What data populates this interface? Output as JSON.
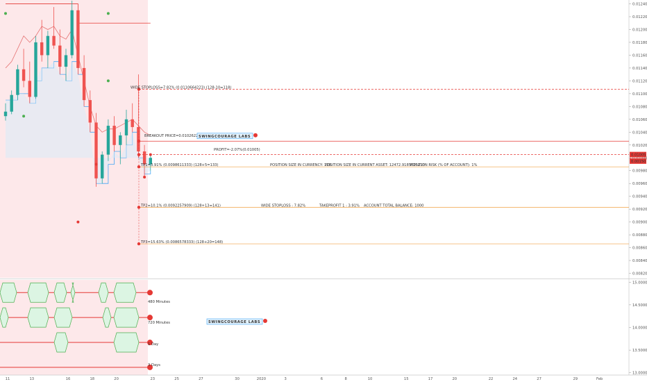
{
  "chart_data": {
    "type": "candlestick",
    "price_axis_ticks": [
      "0.01240",
      "0.01220",
      "0.01200",
      "0.01180",
      "0.01160",
      "0.01140",
      "0.01120",
      "0.01100",
      "0.01080",
      "0.01060",
      "0.01040",
      "0.01020",
      "0.01000",
      "0.00980",
      "0.00960",
      "0.00940",
      "0.00920",
      "0.00900",
      "0.00880",
      "0.00860",
      "0.00840",
      "0.00820"
    ],
    "ylim": [
      0.00813,
      0.01246
    ],
    "osc_axis_ticks": [
      "15.00000",
      "14.50000",
      "14.00000",
      "13.50000",
      "13.00000"
    ],
    "osc_ylim": [
      12.95,
      15.05
    ],
    "x_axis_ticks": [
      {
        "label": "11",
        "idx": 0
      },
      {
        "label": "13",
        "idx": 4
      },
      {
        "label": "16",
        "idx": 10
      },
      {
        "label": "18",
        "idx": 14
      },
      {
        "label": "20",
        "idx": 18
      },
      {
        "label": "23",
        "idx": 24
      },
      {
        "label": "25",
        "idx": 28
      },
      {
        "label": "27",
        "idx": 32
      },
      {
        "label": "30",
        "idx": 38
      },
      {
        "label": "2020",
        "idx": 42
      },
      {
        "label": "3",
        "idx": 46
      },
      {
        "label": "6",
        "idx": 52
      },
      {
        "label": "8",
        "idx": 56
      },
      {
        "label": "10",
        "idx": 60
      },
      {
        "label": "15",
        "idx": 66
      },
      {
        "label": "17",
        "idx": 70
      },
      {
        "label": "20",
        "idx": 74
      },
      {
        "label": "22",
        "idx": 80
      },
      {
        "label": "24",
        "idx": 84
      },
      {
        "label": "27",
        "idx": 88
      },
      {
        "label": "29",
        "idx": 94
      },
      {
        "label": "Feb",
        "idx": 98
      }
    ],
    "candles": [
      [
        0.01065,
        0.01085,
        0.01058,
        0.01072
      ],
      [
        0.01072,
        0.01105,
        0.01068,
        0.01098
      ],
      [
        0.01098,
        0.01145,
        0.0109,
        0.01138
      ],
      [
        0.01138,
        0.0117,
        0.0111,
        0.0112
      ],
      [
        0.0112,
        0.0115,
        0.01085,
        0.01095
      ],
      [
        0.01095,
        0.0119,
        0.01092,
        0.0118
      ],
      [
        0.0118,
        0.01215,
        0.0115,
        0.0116
      ],
      [
        0.0116,
        0.01198,
        0.0114,
        0.0119
      ],
      [
        0.0119,
        0.01235,
        0.0117,
        0.01175
      ],
      [
        0.01175,
        0.012,
        0.0113,
        0.01142
      ],
      [
        0.01142,
        0.0117,
        0.0112,
        0.0116
      ],
      [
        0.0116,
        0.01245,
        0.01155,
        0.0123
      ],
      [
        0.0123,
        0.01236,
        0.0113,
        0.0114
      ],
      [
        0.0114,
        0.0116,
        0.0108,
        0.0109
      ],
      [
        0.0109,
        0.01105,
        0.0104,
        0.01055
      ],
      [
        0.01055,
        0.0107,
        0.00955,
        0.00968
      ],
      [
        0.00968,
        0.0101,
        0.0096,
        0.01005
      ],
      [
        0.01005,
        0.0106,
        0.00995,
        0.0105
      ],
      [
        0.0105,
        0.01065,
        0.0101,
        0.0102
      ],
      [
        0.0102,
        0.0104,
        0.0099,
        0.01035
      ],
      [
        0.01035,
        0.01075,
        0.0102,
        0.0106
      ],
      [
        0.0106,
        0.01085,
        0.0104,
        0.01048
      ],
      [
        0.01048,
        0.0113,
        0.01,
        0.0101
      ],
      [
        0.0101,
        0.0102,
        0.0097,
        0.0099
      ],
      [
        0.0099,
        0.01005,
        0.0098,
        0.01
      ]
    ],
    "lines": [
      {
        "label": "WIDE STOPLOSS=7.82% (0.0110664223) (128-10=118)",
        "price": 0.01107,
        "color": "#e53935",
        "dashed": true
      },
      {
        "label": "BREAKOUT PRICE=0.0102622333",
        "price": 0.01026,
        "color": "#e53935",
        "dashed": false
      },
      {
        "label": "PROFIT=-2.07%(0.01005)",
        "price": 0.01005,
        "color": "#e53935",
        "dashed": true
      },
      {
        "label": "TP1=3.91% (0.0098611333) (128+5=133)",
        "price": 0.00986,
        "color": "#f0a040",
        "dashed": false
      },
      {
        "label": "TP2=10.1% (0.0092257909) (128+13=141)",
        "price": 0.00923,
        "color": "#f0a040",
        "dashed": false
      },
      {
        "label": "TP3=15.63% (0.0086578333) (128+20=148)",
        "price": 0.00866,
        "color": "#f0a040",
        "dashed": false
      }
    ],
    "info_texts": [
      "POSITION SIZE IN CURRENCY: 128",
      "POSITION SIZE IN CURRENT ASSET: 12472.9185005213",
      "POSITION RISK (% OF ACCOUNT): 1%",
      "WIDE STOPLOSS : 7.82%",
      "TAKEPROFIT 1 : 3.91%",
      "ACCOUNT TOTAL BALANCE: 1000"
    ],
    "price_badges": [
      {
        "text": "0.01005",
        "color": "#e53935",
        "price": 0.01005
      },
      {
        "text": "0.00150",
        "color": "#e53935",
        "price": 0.00995
      }
    ],
    "logo_text": "SWINGCOURAGE LABS",
    "osc_labels": [
      "480 Minutes",
      "720 Minutes",
      "1 Day",
      "3 Days"
    ]
  }
}
